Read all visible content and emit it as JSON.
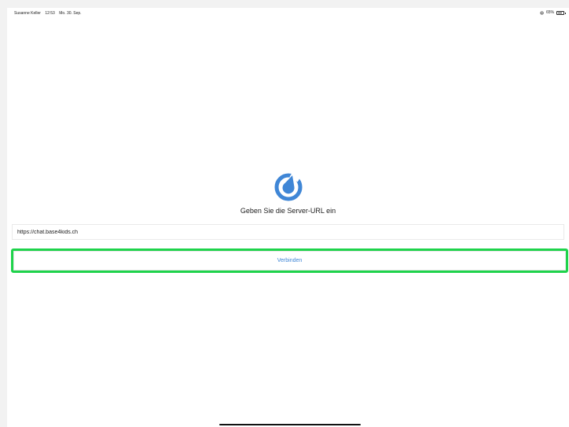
{
  "status_bar": {
    "user": "Susanne Keller",
    "time": "12:53",
    "date": "Mo. 30. Sep.",
    "battery": "65%",
    "icons": [
      "orientation-lock-icon",
      "battery-icon"
    ]
  },
  "app": {
    "logo_icon": "mattermost-logo-icon",
    "accent_color": "#3f86d6",
    "prompt": "Geben Sie die Server-URL ein",
    "url_value": "https://chat.base4kids.ch",
    "connect_label": "Verbinden",
    "highlight_color": "#1ed34b"
  }
}
